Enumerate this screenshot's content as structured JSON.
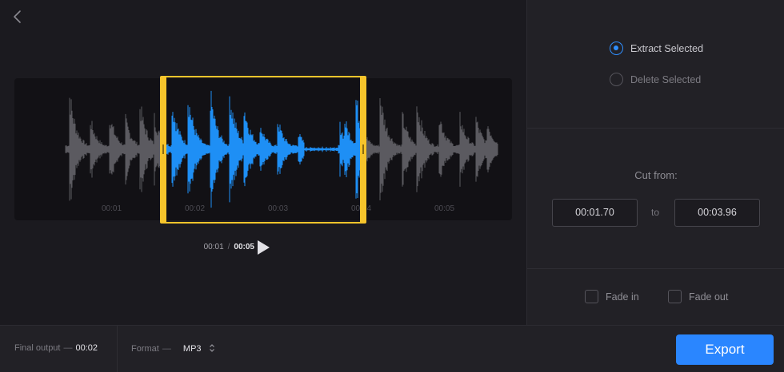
{
  "icons": {
    "back": "chevron-left-icon",
    "play": "play-icon",
    "select_arrows": "up-down-chevron-icon"
  },
  "colors": {
    "accent": "#2a86ff",
    "selection": "#f6c42b",
    "wave_selected": "#1e8ff5",
    "wave_unselected": "#5b5a60"
  },
  "timeline": {
    "ticks": [
      "00:01",
      "00:02",
      "00:03",
      "00:04",
      "00:05"
    ],
    "selection_start_s": 1.7,
    "selection_end_s": 3.96,
    "duration_s": 5
  },
  "player": {
    "current": "00:01",
    "separator": "/",
    "total": "00:05"
  },
  "mode": {
    "options": [
      {
        "label": "Extract Selected",
        "checked": true
      },
      {
        "label": "Delete Selected",
        "checked": false
      }
    ]
  },
  "cut": {
    "title": "Cut from:",
    "from": "00:01.70",
    "to_label": "to",
    "to": "00:03.96"
  },
  "fades": {
    "fade_in": "Fade in",
    "fade_out": "Fade out"
  },
  "footer": {
    "final_output_label": "Final output",
    "dash": "—",
    "final_output_value": "00:02",
    "format_label": "Format",
    "format_value": "MP3",
    "export_label": "Export"
  }
}
